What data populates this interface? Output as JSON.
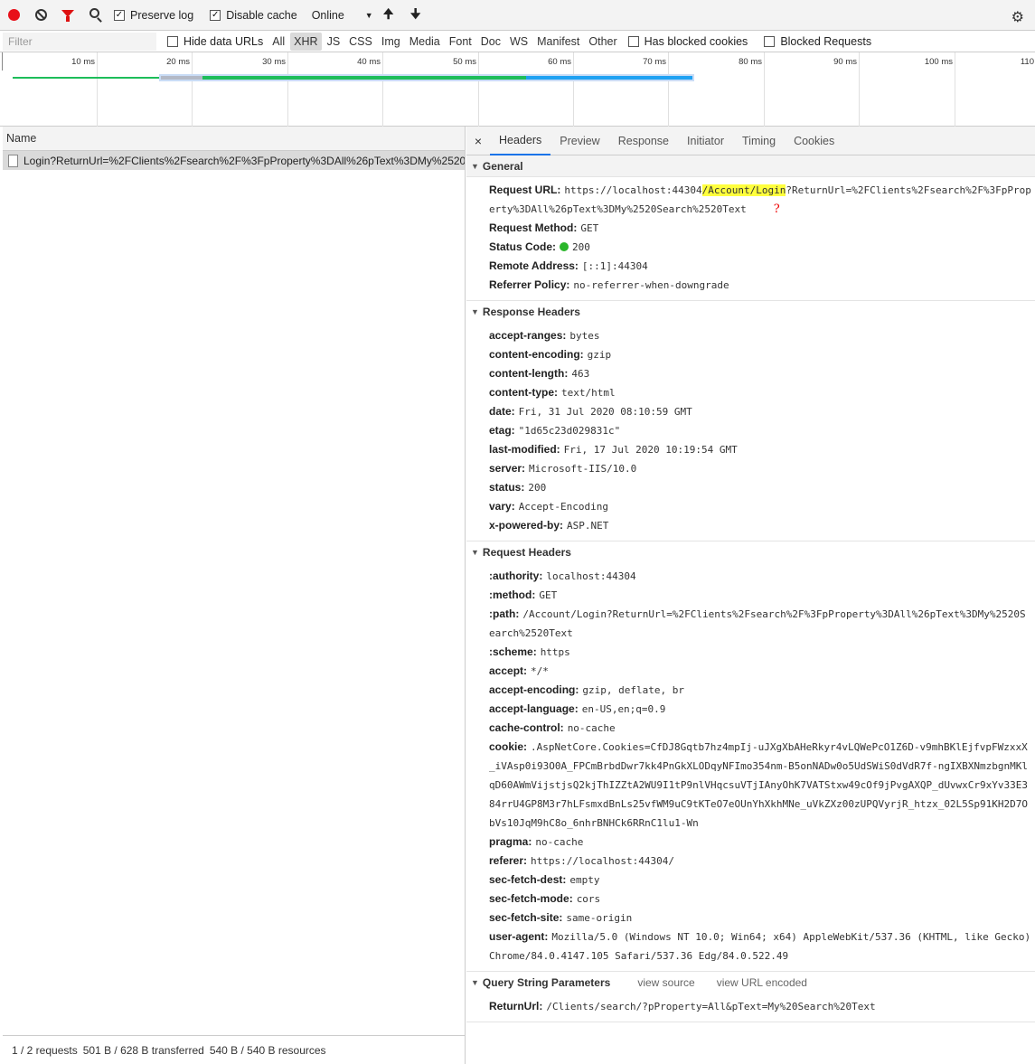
{
  "toolbar": {
    "preserve_log": "Preserve log",
    "disable_cache": "Disable cache",
    "throttle": "Online",
    "checkmark": "✓",
    "dropdown_glyph": "▼",
    "upload_glyph": "🠉",
    "download_glyph": "🠋",
    "gear_glyph": "⚙"
  },
  "filterbar": {
    "placeholder": "Filter",
    "hide_data_urls": "Hide data URLs",
    "types": [
      "All",
      "XHR",
      "JS",
      "CSS",
      "Img",
      "Media",
      "Font",
      "Doc",
      "WS",
      "Manifest",
      "Other"
    ],
    "active_type": "XHR",
    "blocked_cookies": "Has blocked cookies",
    "blocked_requests": "Blocked Requests"
  },
  "timeline": {
    "ticks": [
      "10 ms",
      "20 ms",
      "30 ms",
      "40 ms",
      "50 ms",
      "60 ms",
      "70 ms",
      "80 ms",
      "90 ms",
      "100 ms",
      "110"
    ],
    "colors": {
      "green": "#1dbd5a",
      "blue": "#1ea1f2",
      "gray": "#b3b9c6"
    }
  },
  "request_list": {
    "column_name": "Name",
    "row": "Login?ReturnUrl=%2FClients%2Fsearch%2F%3FpProperty%3DAll%26pText%3DMy%2520...",
    "status": {
      "requests": "1 / 2 requests",
      "transferred": "501 B / 628 B transferred",
      "resources": "540 B / 540 B resources"
    }
  },
  "tabs": {
    "close": "×",
    "items": [
      "Headers",
      "Preview",
      "Response",
      "Initiator",
      "Timing",
      "Cookies"
    ],
    "active": "Headers"
  },
  "general": {
    "title": "General",
    "request_url_key": "Request URL:",
    "request_url_pre": "https://localhost:44304",
    "request_url_highlight": "/Account/Login",
    "request_url_post": "?ReturnUrl=%2FClients%2Fsearch%2F%3FpProperty%3DAll%26pText%3DMy%2520Search%2520Text",
    "annotation": "?",
    "request_method_key": "Request Method:",
    "request_method": "GET",
    "status_code_key": "Status Code:",
    "status_code": "200",
    "remote_address_key": "Remote Address:",
    "remote_address": "[::1]:44304",
    "referrer_policy_key": "Referrer Policy:",
    "referrer_policy": "no-referrer-when-downgrade"
  },
  "response_headers": {
    "title": "Response Headers",
    "items": [
      {
        "k": "accept-ranges:",
        "v": "bytes"
      },
      {
        "k": "content-encoding:",
        "v": "gzip"
      },
      {
        "k": "content-length:",
        "v": "463"
      },
      {
        "k": "content-type:",
        "v": "text/html"
      },
      {
        "k": "date:",
        "v": "Fri, 31 Jul 2020 08:10:59 GMT"
      },
      {
        "k": "etag:",
        "v": "\"1d65c23d029831c\""
      },
      {
        "k": "last-modified:",
        "v": "Fri, 17 Jul 2020 10:19:54 GMT"
      },
      {
        "k": "server:",
        "v": "Microsoft-IIS/10.0"
      },
      {
        "k": "status:",
        "v": "200"
      },
      {
        "k": "vary:",
        "v": "Accept-Encoding"
      },
      {
        "k": "x-powered-by:",
        "v": "ASP.NET"
      }
    ]
  },
  "request_headers": {
    "title": "Request Headers",
    "items": [
      {
        "k": ":authority:",
        "v": "localhost:44304"
      },
      {
        "k": ":method:",
        "v": "GET"
      },
      {
        "k": ":path:",
        "v": "/Account/Login?ReturnUrl=%2FClients%2Fsearch%2F%3FpProperty%3DAll%26pText%3DMy%2520Search%2520Text"
      },
      {
        "k": ":scheme:",
        "v": "https"
      },
      {
        "k": "accept:",
        "v": "*/*"
      },
      {
        "k": "accept-encoding:",
        "v": "gzip, deflate, br"
      },
      {
        "k": "accept-language:",
        "v": "en-US,en;q=0.9"
      },
      {
        "k": "cache-control:",
        "v": "no-cache"
      },
      {
        "k": "cookie:",
        "v": ".AspNetCore.Cookies=CfDJ8Gqtb7hz4mpIj-uJXgXbAHeRkyr4vLQWePcO1Z6D-v9mhBKlEjfvpFWzxxX_iVAsp0i93O0A_FPCmBrbdDwr7kk4PnGkXLODqyNFImo354nm-B5onNADw0o5UdSWiS0dVdR7f-ngIXBXNmzbgnMKlqD60AWmVijstjsQ2kjThIZZtA2WU9I1tP9nlVHqcsuVTjIAnyOhK7VATStxw49cOf9jPvgAXQP_dUvwxCr9xYv33E384rrU4GP8M3r7hLFsmxdBnLs25vfWM9uC9tKTeO7eOUnYhXkhMNe_uVkZXz00zUPQVyrjR_htzx_02L5Sp91KH2D7ObVs10JqM9hC8o_6nhrBNHCk6RRnC1lu1-Wn"
      },
      {
        "k": "pragma:",
        "v": "no-cache"
      },
      {
        "k": "referer:",
        "v": "https://localhost:44304/"
      },
      {
        "k": "sec-fetch-dest:",
        "v": "empty"
      },
      {
        "k": "sec-fetch-mode:",
        "v": "cors"
      },
      {
        "k": "sec-fetch-site:",
        "v": "same-origin"
      },
      {
        "k": "user-agent:",
        "v": "Mozilla/5.0 (Windows NT 10.0; Win64; x64) AppleWebKit/537.36 (KHTML, like Gecko) Chrome/84.0.4147.105 Safari/537.36 Edg/84.0.522.49"
      }
    ]
  },
  "query_params": {
    "title": "Query String Parameters",
    "view_source": "view source",
    "view_url_encoded": "view URL encoded",
    "items": [
      {
        "k": "ReturnUrl:",
        "v": "/Clients/search/?pProperty=All&pText=My%20Search%20Text"
      }
    ]
  }
}
